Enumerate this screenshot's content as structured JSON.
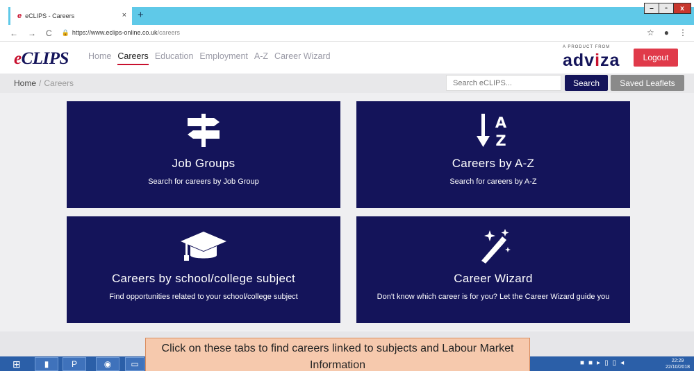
{
  "browser": {
    "tab_title": "eCLIPS - Careers",
    "tab_close": "×",
    "new_tab": "+",
    "url_host": "https://www.eclips-online.co.uk",
    "url_path": "/careers",
    "win_minimize": "–",
    "win_restore": "▫",
    "win_close": "x"
  },
  "header": {
    "logo_e": "e",
    "logo_rest": "CLIPS",
    "nav": [
      "Home",
      "Careers",
      "Education",
      "Employment",
      "A-Z",
      "Career Wizard"
    ],
    "active_nav": "Careers",
    "product_from": "A PRODUCT FROM",
    "brand_a": "adv",
    "brand_i": "i",
    "brand_b": "za",
    "logout": "Logout"
  },
  "breadcrumb": {
    "home": "Home",
    "sep": "/",
    "current": "Careers"
  },
  "search": {
    "placeholder": "Search eCLIPS...",
    "button": "Search",
    "saved": "Saved Leaflets"
  },
  "cards": [
    {
      "title": "Job Groups",
      "subtitle": "Search for careers by Job Group",
      "icon": "signpost-icon"
    },
    {
      "title": "Careers by A-Z",
      "subtitle": "Search for careers by A-Z",
      "icon": "sort-az-icon"
    },
    {
      "title": "Careers by school/college subject",
      "subtitle": "Find opportunities related to your school/college subject",
      "icon": "graduation-cap-icon"
    },
    {
      "title": "Career Wizard",
      "subtitle": "Don't know which career is for you? Let the Career Wizard guide you",
      "icon": "magic-wand-icon"
    }
  ],
  "callout": {
    "text": "Click on these tabs to find careers linked to subjects and Labour Market Information"
  },
  "taskbar": {
    "time": "22:29",
    "date": "22/10/2018"
  },
  "colors": {
    "brand_navy": "#14145a",
    "brand_red": "#c8102e",
    "logout_red": "#e03a4a",
    "tab_strip": "#5fc9e8",
    "callout_bg": "#f6c9ad"
  }
}
